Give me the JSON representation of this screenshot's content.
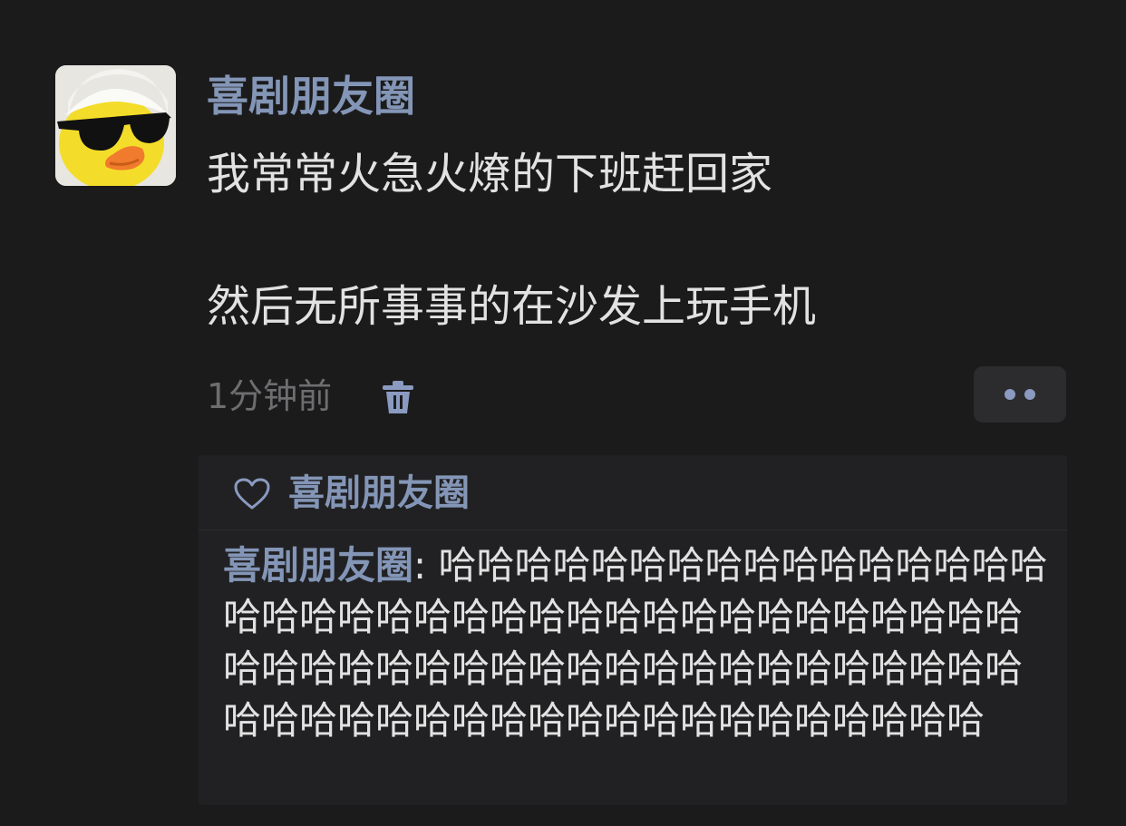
{
  "post": {
    "author": "喜剧朋友圈",
    "text_line_1": "我常常火急火燎的下班赶回家",
    "text_line_2": "然后无所事事的在沙发上玩手机",
    "time": "1分钟前",
    "avatar_icon": "duck-with-sunglasses-avatar",
    "delete_icon": "trash-icon",
    "more_icon": "more-dots-icon"
  },
  "likes": {
    "icon": "heart-outline-icon",
    "names": [
      "喜剧朋友圈"
    ]
  },
  "comments": [
    {
      "author": "喜剧朋友圈",
      "separator": ": ",
      "text": "哈哈哈哈哈哈哈哈哈哈哈哈哈哈哈哈哈哈哈哈哈哈哈哈哈哈哈哈哈哈哈哈哈哈哈哈哈哈哈哈哈哈哈哈哈哈哈哈哈哈哈哈哈哈哈哈哈哈哈哈哈哈哈哈哈哈哈哈哈哈哈哈哈哈哈哈哈哈"
    }
  ],
  "colors": {
    "background": "#1b1b1c",
    "panel": "#212123",
    "name_blue": "#8496b7",
    "text": "#e2e2e2",
    "muted": "#6e6e70"
  }
}
